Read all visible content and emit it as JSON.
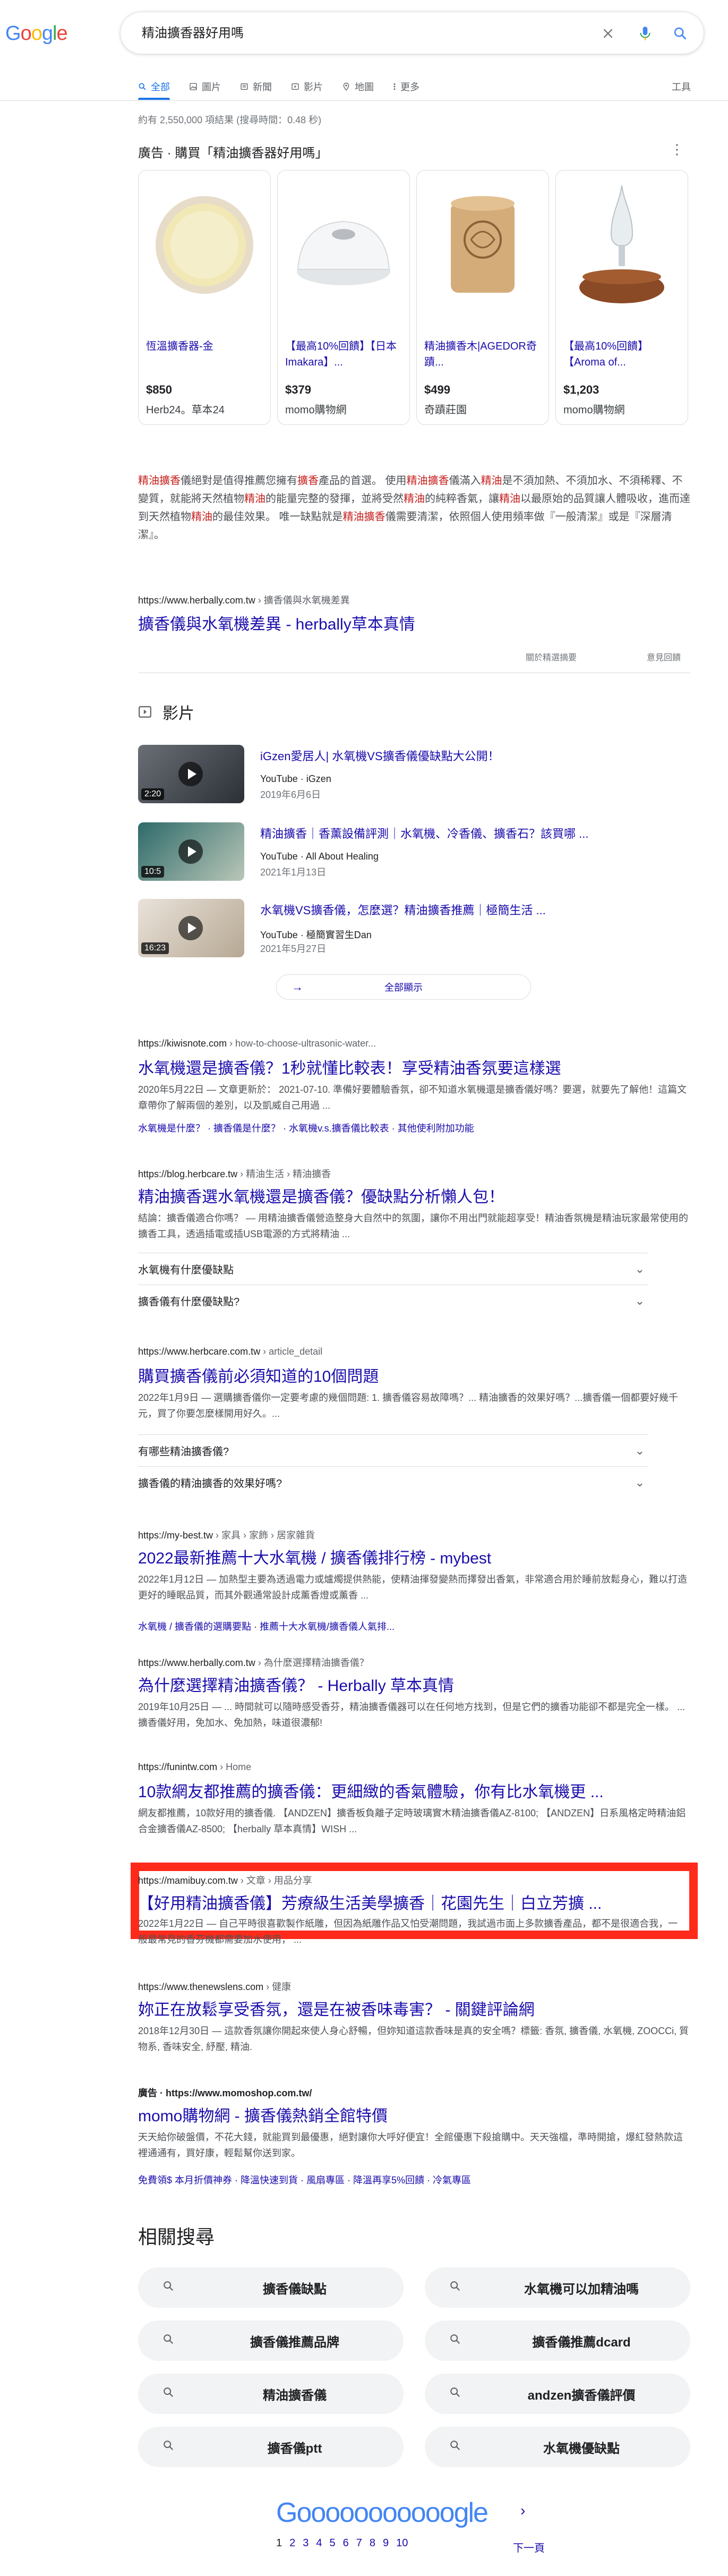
{
  "search": {
    "query": "精油擴香器好用嗎"
  },
  "tabs": [
    {
      "label": "全部",
      "icon": "search-icon",
      "active": true
    },
    {
      "label": "圖片",
      "icon": "image-icon"
    },
    {
      "label": "新聞",
      "icon": "news-icon"
    },
    {
      "label": "影片",
      "icon": "video-icon"
    },
    {
      "label": "地圖",
      "icon": "map-pin-icon"
    },
    {
      "label": "更多",
      "icon": "more-icon"
    }
  ],
  "tools_label": "工具",
  "stats": "約有 2,550,000 項結果 (搜尋時間：0.48 秒)",
  "ad": {
    "prefix": "廣告 · 購買「精油擴香器好用嗎」",
    "products": [
      {
        "title": "恆溫擴香器-金",
        "price": "$850",
        "store": "Herb24。草本24"
      },
      {
        "title": "【最高10%回饋】【日本Imakara】...",
        "price": "$379",
        "store": "momo購物網"
      },
      {
        "title": "精油擴香木|AGEDOR奇蹟...",
        "price": "$499",
        "store": "奇蹟莊園"
      },
      {
        "title": "【最高10%回饋】【Aroma of...",
        "price": "$1,203",
        "store": "momo購物網"
      }
    ]
  },
  "featured": {
    "text1": "精油擴香",
    "text2": "儀絕對是值得推薦您擁有",
    "text3": "擴香",
    "text4": "產品的首選。 使用",
    "text5": "精油擴香",
    "text6": "儀滿入",
    "text7": "精油",
    "text8": "是不須加熱、不須加水、不須稀釋、不變質，就能將天然植物",
    "text9": "精油",
    "text10": "的能量完整的發揮，並將受然",
    "text11": "精油",
    "text12": "的純粹香氣，讓",
    "text13": "精油",
    "text14": "以最原始的品質讓人體吸收，進而達到天然植物",
    "text15": "精油",
    "text16": "的最佳效果。 唯一缺點就是",
    "text17": "精油擴香",
    "text18": "儀需要清潔，依照個人使用頻率做『一般清潔』或是『深層清潔』。",
    "url": "https://www.herbally.com.tw",
    "path": " › 擴香儀與水氧機差異",
    "title": "擴香儀與水氧機差異 - herbally草本真情",
    "about": "關於精選摘要",
    "feedback": "意見回饋"
  },
  "videos": {
    "heading": "影片",
    "items": [
      {
        "title": "iGzen愛居人| 水氧機VS擴香儀優缺點大公開！",
        "source": "YouTube · iGzen",
        "date": "2019年6月6日",
        "duration": "2:20"
      },
      {
        "title": "精油擴香｜香薰設備評測｜水氧機、冷香儀、擴香石？該買哪 ...",
        "source": "YouTube · All About Healing",
        "date": "2021年1月13日",
        "duration": "10:5"
      },
      {
        "title": "水氧機VS擴香儀，怎麼選？精油擴香推薦｜極簡生活 ...",
        "source": "YouTube · 極簡實習生Dan",
        "date": "2021年5月27日",
        "duration": "16:23"
      }
    ],
    "view_all": "全部顯示"
  },
  "results": [
    {
      "url": "https://kiwisnote.com",
      "path": " › how-to-choose-ultrasonic-water...",
      "title": "水氧機還是擴香儀？1秒就懂比較表！享受精油香氛要這樣選",
      "snippet": "2020年5月22日 — 文章更新於： 2021-07-10. 準備好要體驗香氛，卻不知道水氧機還是擴香儀好嗎？要選，就要先了解他！這篇文章帶你了解兩個的差別，以及凱威自己用過 ...",
      "sublinks": "水氧機是什麼？ · 擴香儀是什麼？ · 水氧機v.s.擴香儀比較表 · 其他使利附加功能"
    },
    {
      "url": "https://blog.herbcare.tw",
      "path": " › 精油生活 › 精油擴香",
      "title": "精油擴香選水氧機還是擴香儀？優缺點分析懶人包！",
      "snippet": "結論：擴香儀適合你嗎？ — 用精油擴香儀營造整身大自然中的氛圍，讓你不用出門就能超享受！精油香氛機是精油玩家最常使用的擴香工具，透過插電或插USB電源的方式將精油 ...",
      "paa": [
        "水氧機有什麼優缺點",
        "擴香儀有什麼優缺點?"
      ]
    },
    {
      "url": "https://www.herbcare.com.tw",
      "path": " › article_detail",
      "title": "購買擴香儀前必須知道的10個問題",
      "snippet": "2022年1月9日 — 選購擴香儀你一定要考慮的幾個問題: 1. 擴香儀容易故障嗎？... 精油擴香的效果好嗎？...擴香儀一個都要好幾千元，買了你要怎麼樣開用好久。...",
      "paa": [
        "有哪些精油擴香儀?",
        "擴香儀的精油擴香的效果好嗎?"
      ]
    },
    {
      "url": "https://my-best.tw",
      "path": " › 家具 › 家飾 › 居家雜貨",
      "title": "2022最新推薦十大水氧機 / 擴香儀排行榜 - mybest",
      "snippet": "2022年1月12日 — 加熱型主要為透過電力或爐燭提供熱能，使精油揮發變熱而擇發出香氣，非常適合用於睡前放鬆身心，難以打造更好的睡眠品質，而其外觀通常設計成薰香燈或薰香 ...",
      "sublinks": "水氧機 / 擴香儀的選購要點 · 推薦十大水氧機/擴香儀人氣排..."
    },
    {
      "url": "https://www.herbally.com.tw",
      "path": " › 為什麼選擇精油擴香儀？",
      "title": "為什麼選擇精油擴香儀？ - Herbally 草本真情",
      "snippet": "2019年10月25日 — ... 時間就可以隨時感受香芬，精油擴香儀器可以在任何地方找到，但是它們的擴香功能卻不都是完全一樣。 ... 擴香儀好用，免加水、免加熱，味道很濃郁!"
    },
    {
      "url": "https://funintw.com",
      "path": " › Home",
      "title": "10款網友都推薦的擴香儀：更細緻的香氣體驗，你有比水氧機更 ...",
      "snippet": "網友都推薦，10款好用的擴香儀. 【ANDZEN】擴香板負離子定時玻璃實木精油擴香儀AZ-8100; 【ANDZEN】日系風格定時精油鋁合金擴香儀AZ-8500; 【herbally 草本真情】WISH ..."
    },
    {
      "url": "https://mamibuy.com.tw",
      "path": " › 文章 › 用品分享",
      "title": "【好用精油擴香儀】芳療級生活美學擴香｜花園先生｜白立芳擴 ...",
      "snippet": "2022年1月22日 — 自己平時很喜歡製作紙雕，但因為紙雕作品又怕受潮問題，我試過市面上多款擴香產品，都不是很適合我，一般最常見的香芬機都需要加水使用， ..."
    },
    {
      "url": "https://www.thenewslens.com",
      "path": " › 健康",
      "title": "妳正在放鬆享受香氛，還是在被香味毒害？ - 關鍵評論網",
      "snippet": "2018年12月30日 — 這款香氛讓你開起來使人身心舒暢，但妳知道這款香味是真的安全嗎？標籤: 香氛, 擴香儀, 水氧機, ZOOCCi, 質物系, 香味安全, 紓壓, 精油."
    },
    {
      "url": "廣告 · https://www.momoshop.com.tw/",
      "title": "momo購物網 - 擴香儀熱銷全館特價",
      "snippet": "天天給你破盤價，不花大錢，就能買到最優惠，絕對讓你大呼好便宜！全館優惠下殺搶購中。天天強檔，準時開搶，爆紅發熱款這裡通通有，買好康，輕鬆幫你送到家。",
      "sublinks": "免費領$ 本月折價神券 · 降溫快速到貨 · 風扇專區 · 降溫再享5%回饋 · 冷氣專區"
    }
  ],
  "related": {
    "heading": "相關搜尋",
    "items": [
      "擴香儀缺點",
      "水氧機可以加精油嗎",
      "擴香儀推薦品牌",
      "擴香儀推薦dcard",
      "精油擴香儀",
      "andzen擴香儀評價",
      "擴香儀ptt",
      "水氧機優缺點"
    ]
  },
  "pager": {
    "logo": "Gooooooooooogle",
    "pages": [
      "1",
      "2",
      "3",
      "4",
      "5",
      "6",
      "7",
      "8",
      "9",
      "10"
    ],
    "next": "下一頁"
  }
}
